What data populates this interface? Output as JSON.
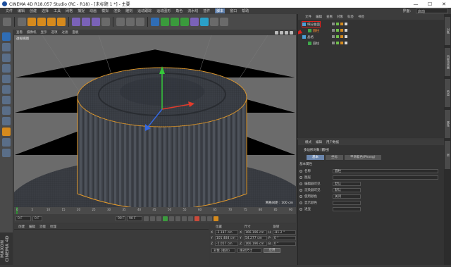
{
  "window": {
    "title": "CINEMA 4D R18.057 Studio (RC - R18) - [未标题 1 *] - 主要",
    "minimize": "—",
    "maximize": "☐",
    "close": "✕"
  },
  "menubar": {
    "items": [
      "文件",
      "编辑",
      "创建",
      "选择",
      "工具",
      "网格",
      "捕捉",
      "动画",
      "模拟",
      "渲染",
      "雕刻",
      "运动跟踪",
      "运动图形",
      "角色",
      "流水线",
      "插件",
      "脚本",
      "窗口",
      "帮助"
    ],
    "active_index": 16,
    "layout_label": "界面:",
    "layout_value": "启动"
  },
  "toolbar": {
    "colors": {
      "blue": "#2f6db5",
      "orange": "#d58a1d",
      "green": "#3a9a3c",
      "purple": "#7a62b8",
      "gray": "#6a6a6a",
      "cyan": "#2aa0c8"
    }
  },
  "viewport": {
    "menu": [
      "查看",
      "摄像机",
      "显示",
      "选项",
      "过滤",
      "面板"
    ],
    "label": "透视视图",
    "status": "网格间距 : 100 cm"
  },
  "timeline": {
    "ticks": [
      "0",
      "5",
      "10",
      "15",
      "20",
      "25",
      "30",
      "35",
      "40",
      "45",
      "50",
      "55",
      "60",
      "65",
      "70",
      "75",
      "80",
      "85",
      "90"
    ],
    "current_frame": "0 F"
  },
  "transport": {
    "start": "0 F",
    "current": "0 F",
    "end": "90 F",
    "max": "90 F"
  },
  "material": {
    "menu": [
      "创建",
      "编辑",
      "功能",
      "纹理"
    ]
  },
  "coordinates": {
    "headers": [
      "位置",
      "尺寸",
      "旋转"
    ],
    "rows": [
      {
        "axis": "X",
        "pos": "-3.187 cm",
        "size_axis": "X",
        "size": "166.196 cm",
        "rot_axis": "H",
        "rot": "-81.2 °"
      },
      {
        "axis": "Y",
        "pos": "101.484 cm",
        "size_axis": "Y",
        "size": "54.277 cm",
        "rot_axis": "P",
        "rot": "0 °"
      },
      {
        "axis": "Z",
        "pos": "-5.057 cm",
        "size_axis": "Z",
        "size": "166.196 cm",
        "rot_axis": "B",
        "rot": "0 °"
      }
    ],
    "mode_object": "对象 (相对)",
    "mode_size": "绝对尺寸",
    "apply": "应用"
  },
  "object_manager": {
    "menu": [
      "文件",
      "编辑",
      "查看",
      "对象",
      "标签",
      "书签"
    ],
    "objects": [
      {
        "name": "细分曲面",
        "indent": 0,
        "icon_color": "#4a9fd8",
        "selected": false,
        "highlight": true
      },
      {
        "name": "圆柱",
        "indent": 1,
        "icon_color": "#3fa84a",
        "selected": true,
        "highlight": false
      },
      {
        "name": "晶格",
        "indent": 0,
        "icon_color": "#4a9fd8",
        "selected": false,
        "highlight": false
      },
      {
        "name": "圆柱",
        "indent": 1,
        "icon_color": "#3fa84a",
        "selected": false,
        "highlight": false
      }
    ]
  },
  "attribute_manager": {
    "menu": [
      "模式",
      "编辑",
      "用户数据"
    ],
    "title": "多边形对象 [圆柱]",
    "tabs": [
      "基本",
      "坐标",
      "平滑着色(Phong)"
    ],
    "active_tab": 0,
    "section": "基本属性",
    "rows": [
      {
        "label": "名称",
        "value": "圆柱"
      },
      {
        "label": "图层",
        "value": ""
      },
      {
        "label": "编辑器可见",
        "value": "默认"
      },
      {
        "label": "渲染器可见",
        "value": "默认"
      },
      {
        "label": "使用颜色",
        "value": "关闭"
      },
      {
        "label": "显示颜色",
        "value": ""
      },
      {
        "label": "透显",
        "value": ""
      }
    ]
  },
  "right_tabs": [
    "对象",
    "内容浏览器",
    "构造",
    "属性",
    "层"
  ],
  "brand": "MAXON CINEMA 4D"
}
